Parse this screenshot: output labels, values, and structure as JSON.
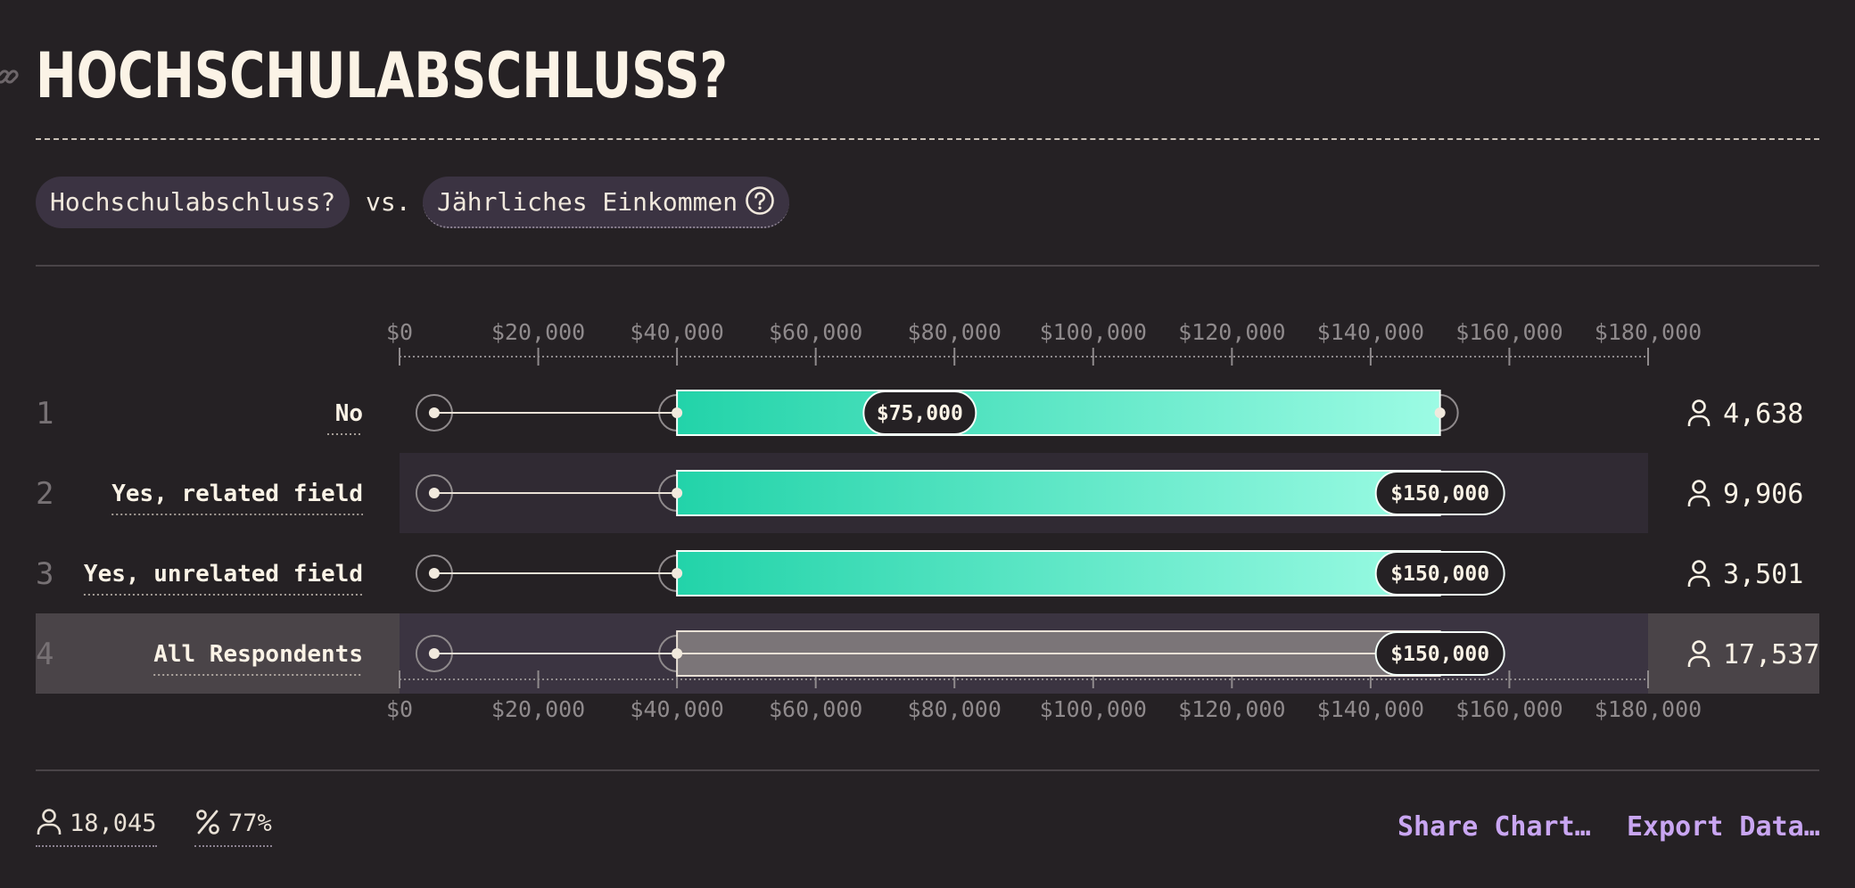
{
  "header": {
    "title": "HOCHSCHULABSCHLUSS?"
  },
  "filters": {
    "left_pill": "Hochschulabschluss?",
    "vs": "vs.",
    "right_pill": "Jährliches Einkommen"
  },
  "chart_data": {
    "type": "bar",
    "title": "",
    "xlabel": "",
    "ylabel": "",
    "xlim": [
      0,
      180000
    ],
    "tick_labels": [
      "$0",
      "$20,000",
      "$40,000",
      "$60,000",
      "$80,000",
      "$100,000",
      "$120,000",
      "$140,000",
      "$160,000",
      "$180,000"
    ],
    "rows": [
      {
        "rank": "1",
        "label": "No",
        "whisker_low": 5000,
        "q1": 40000,
        "median": 75000,
        "q3": 150000,
        "median_label": "$75,000",
        "count": "4,638",
        "highlight": false
      },
      {
        "rank": "2",
        "label": "Yes, related field",
        "whisker_low": 5000,
        "q1": 40000,
        "median": 150000,
        "q3": 150000,
        "median_label": "$150,000",
        "count": "9,906",
        "highlight": false
      },
      {
        "rank": "3",
        "label": "Yes, unrelated field",
        "whisker_low": 5000,
        "q1": 40000,
        "median": 150000,
        "q3": 150000,
        "median_label": "$150,000",
        "count": "3,501",
        "highlight": false
      },
      {
        "rank": "4",
        "label": "All Respondents",
        "whisker_low": 5000,
        "q1": 40000,
        "median": 150000,
        "q3": 150000,
        "median_label": "$150,000",
        "count": "17,537",
        "highlight": true
      }
    ],
    "colors": {
      "bar_start": "#22d3a9",
      "bar_end": "#9cfbe4",
      "all_bar": "#7b7578",
      "bg": "#252124"
    }
  },
  "footer": {
    "respondents": "18,045",
    "percent": "77%",
    "share_label": "Share Chart…",
    "export_label": "Export Data…"
  }
}
